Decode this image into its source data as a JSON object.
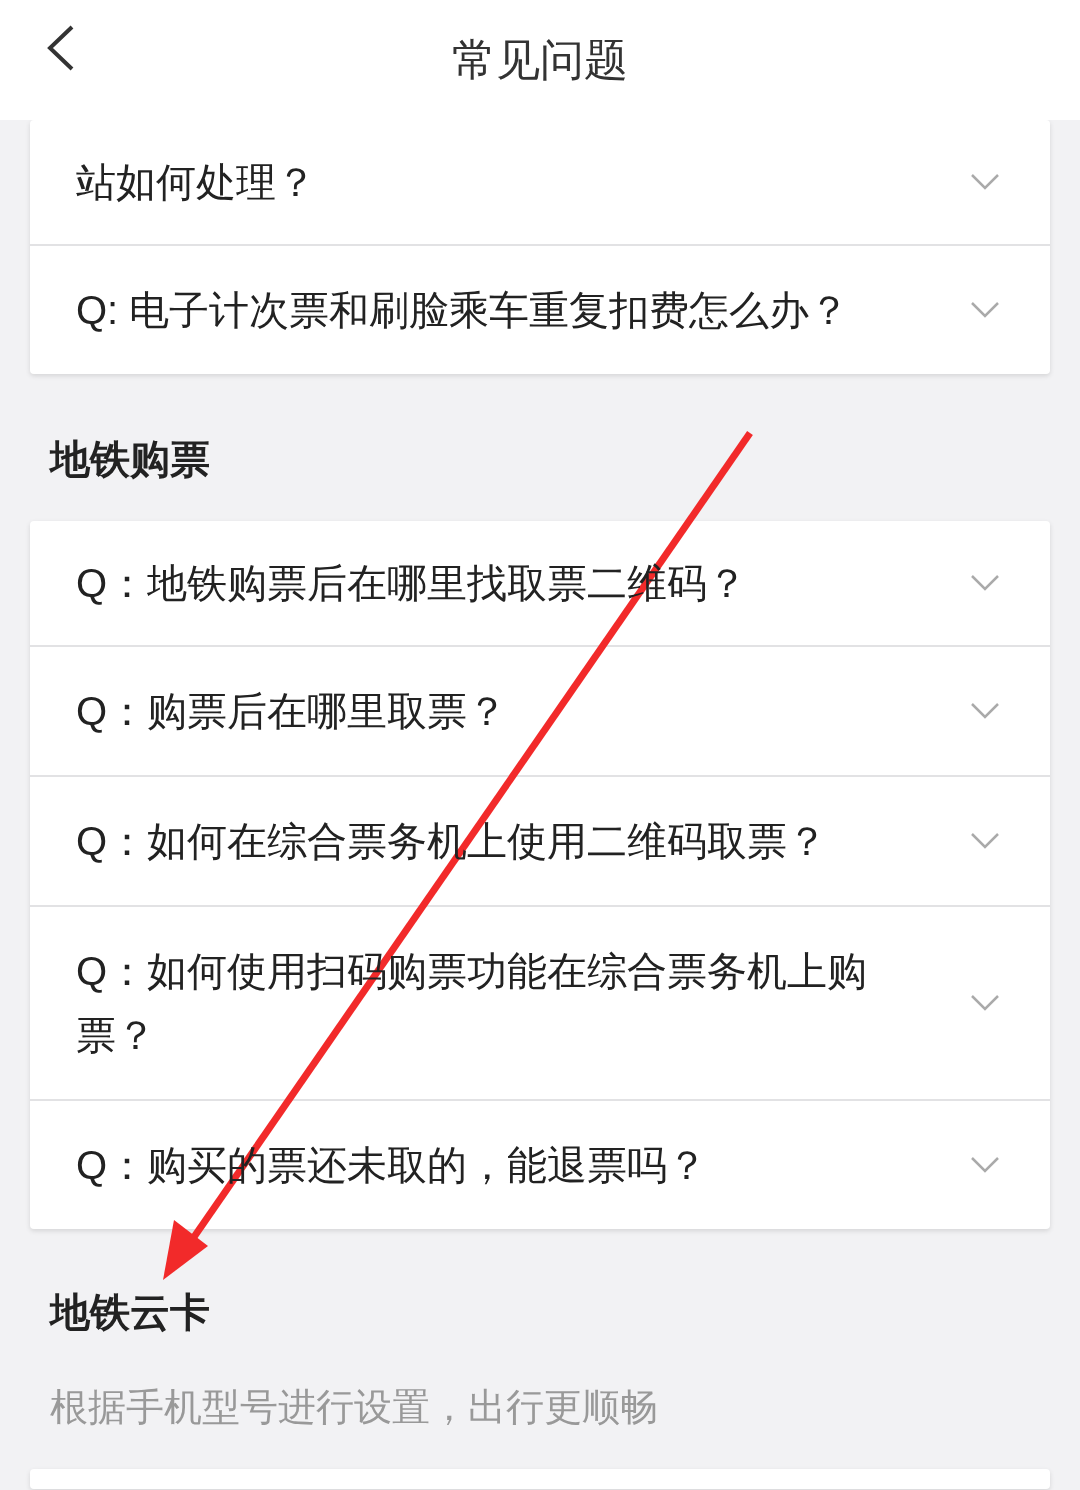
{
  "header": {
    "title": "常见问题"
  },
  "sections": [
    {
      "items": [
        {
          "question": "站如何处理？",
          "expanded": false
        },
        {
          "question": "Q: 电子计次票和刷脸乘车重复扣费怎么办？",
          "expanded": false
        }
      ]
    },
    {
      "title": "地铁购票",
      "items": [
        {
          "question": "Q：地铁购票后在哪里找取票二维码？",
          "expanded": false
        },
        {
          "question": "Q：购票后在哪里取票？",
          "expanded": false
        },
        {
          "question": "Q：如何在综合票务机上使用二维码取票？",
          "expanded": false
        },
        {
          "question": "Q：如何使用扫码购票功能在综合票务机上购票？",
          "expanded": false
        },
        {
          "question": "Q：购买的票还未取的，能退票吗？",
          "expanded": false
        }
      ]
    },
    {
      "title": "地铁云卡",
      "subtitle": "根据手机型号进行设置，出行更顺畅"
    }
  ]
}
